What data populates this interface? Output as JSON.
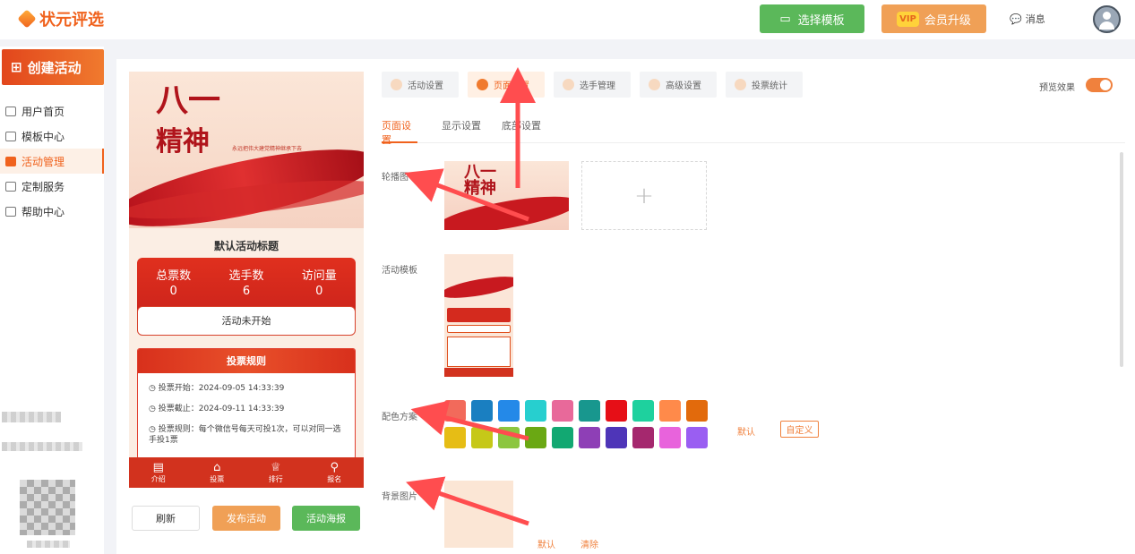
{
  "app": {
    "logo_text": "状元评选",
    "topbar": {
      "template_button": "选择模板",
      "vip_badge": "VIP",
      "vip_button": "会员升级",
      "message": "消息"
    }
  },
  "sidebar": {
    "create_button": "创建活动",
    "items": [
      {
        "label": "用户首页",
        "icon": "home-icon"
      },
      {
        "label": "模板中心",
        "icon": "folder-icon"
      },
      {
        "label": "活动管理",
        "icon": "ticket-icon",
        "active": true
      },
      {
        "label": "定制服务",
        "icon": "link-icon"
      },
      {
        "label": "帮助中心",
        "icon": "help-icon"
      }
    ]
  },
  "preview": {
    "banner_line1": "八一",
    "banner_line2": "精神",
    "banner_slogan": "永远把伟大建党精神继承下去",
    "title": "默认活动标题",
    "stats": [
      {
        "label": "总票数",
        "value": "0"
      },
      {
        "label": "选手数",
        "value": "6"
      },
      {
        "label": "访问量",
        "value": "0"
      }
    ],
    "status": "活动未开始",
    "rules_title": "投票规则",
    "rules": [
      "◷ 投票开始：2024-09-05 14:33:39",
      "◷ 投票截止：2024-09-11 14:33:39",
      "◷ 投票规则：每个微信号每天可投1次，可以对同一选手投1票"
    ],
    "tabs": [
      {
        "label": "介绍",
        "glyph": "▤"
      },
      {
        "label": "投票",
        "glyph": "⌂"
      },
      {
        "label": "排行",
        "glyph": "♕"
      },
      {
        "label": "报名",
        "glyph": "⚲"
      }
    ],
    "buttons": {
      "refresh": "刷新",
      "publish": "发布活动",
      "poster": "活动海报"
    }
  },
  "settings": {
    "tabs": [
      {
        "label": "活动设置",
        "active": false
      },
      {
        "label": "页面设置",
        "active": true
      },
      {
        "label": "选手管理",
        "active": false
      },
      {
        "label": "高级设置",
        "active": false
      },
      {
        "label": "投票统计",
        "active": false
      }
    ],
    "preview_toggle_label": "预览效果",
    "preview_toggle_on": true,
    "subtabs": [
      {
        "label": "页面设置",
        "active": true
      },
      {
        "label": "显示设置",
        "active": false
      },
      {
        "label": "底部设置",
        "active": false
      }
    ],
    "fields": {
      "carousel": "轮播图",
      "template": "活动模板",
      "color_scheme": "配色方案",
      "background": "背景图片"
    },
    "upload_plus": "+",
    "color_default": "默认",
    "color_custom": "自定义",
    "bg_default": "默认",
    "bg_clear": "清除",
    "colors": [
      "#f26a5b",
      "#1a7fc1",
      "#2489e8",
      "#27cfcf",
      "#e8699a",
      "#18978e",
      "#e60f17",
      "#1ed19e",
      "#ff8a4a",
      "#e26a0c",
      "#e6bd15",
      "#c6c818",
      "#8cc63f",
      "#6aa813",
      "#12a872",
      "#8e3fb6",
      "#4e35b8",
      "#a5286e",
      "#e863dc",
      "#9a5ef2"
    ]
  }
}
